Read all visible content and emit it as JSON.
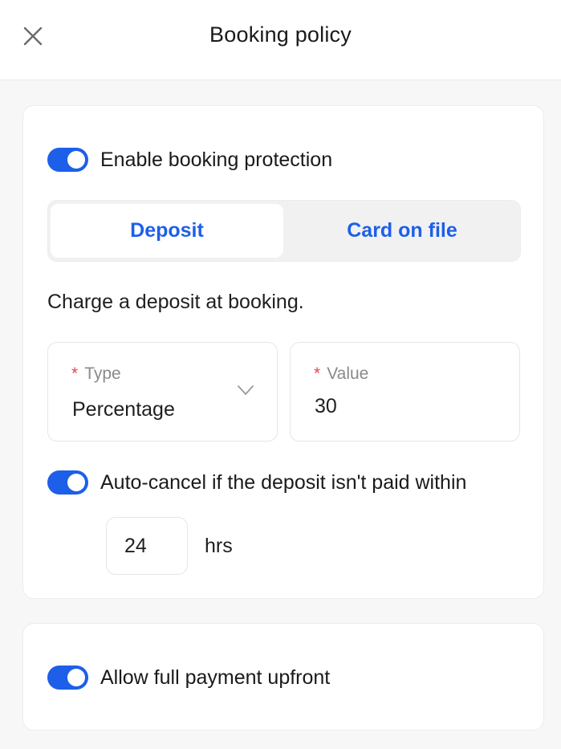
{
  "header": {
    "title": "Booking policy",
    "close_icon": "close-icon"
  },
  "protection": {
    "enabled": true,
    "label": "Enable booking protection",
    "tabs": [
      {
        "label": "Deposit",
        "active": true
      },
      {
        "label": "Card on file",
        "active": false
      }
    ],
    "description": "Charge a deposit at booking.",
    "type_field": {
      "required_mark": "*",
      "label": "Type",
      "value": "Percentage",
      "icon": "chevron-down-icon"
    },
    "value_field": {
      "required_mark": "*",
      "label": "Value",
      "value": "30"
    },
    "auto_cancel": {
      "enabled": true,
      "label": "Auto-cancel if the deposit isn't paid within",
      "hours": "24",
      "unit": "hrs"
    }
  },
  "full_payment": {
    "enabled": true,
    "label": "Allow full payment upfront"
  },
  "colors": {
    "accent": "#1d5fe8",
    "required": "#e5484d"
  }
}
